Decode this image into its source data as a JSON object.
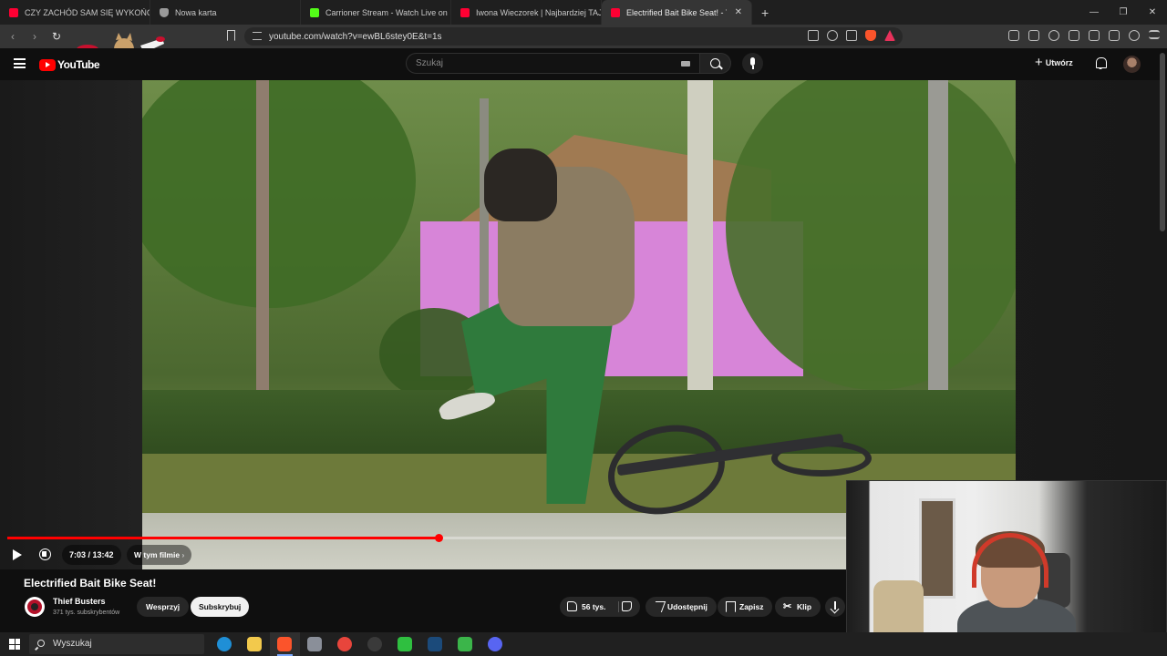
{
  "browser": {
    "tabs": [
      {
        "title": "CZY ZACHÓD SAM SIĘ WYKOŃCZY?",
        "icon": "youtube-icon",
        "color": "#ff0033"
      },
      {
        "title": "Nowa karta",
        "icon": "brave-shield-icon",
        "color": "#9a9a9a"
      },
      {
        "title": "Carrioner Stream - Watch Live on Kick",
        "icon": "kick-icon",
        "color": "#53fc18"
      },
      {
        "title": "Iwona Wieczorek | Najbardziej TAJEMNICZE",
        "icon": "youtube-icon",
        "color": "#ff0033"
      },
      {
        "title": "Electrified Bait Bike Seat! - YouTube",
        "icon": "youtube-icon",
        "color": "#ff0033"
      }
    ],
    "active_tab": 4,
    "url": "youtube.com/watch?v=ewBL6stey0E&t=1s"
  },
  "youtube": {
    "logo_text": "YouTube",
    "search_placeholder": "Szukaj",
    "create_label": "Utwórz"
  },
  "player": {
    "current_time": "7:03",
    "duration": "13:42",
    "time_display": "7:03 / 13:42",
    "progress_fraction": 0.5146,
    "chapters_label": "W tym filmie",
    "accent": "#ff0000"
  },
  "video": {
    "title": "Electrified Bait Bike Seat!",
    "channel_name": "Thief Busters",
    "subscribers": "371 tys. subskrybentów",
    "support_label": "Wesprzyj",
    "subscribe_label": "Subskrybuj",
    "likes": "56 tys.",
    "share_label": "Udostępnij",
    "save_label": "Zapisz",
    "clip_label": "Klip"
  },
  "taskbar": {
    "search_placeholder": "Wyszukaj",
    "apps": [
      {
        "name": "edge-icon",
        "color": "#1f8fd6"
      },
      {
        "name": "file-explorer-icon",
        "color": "#f2c94c"
      },
      {
        "name": "brave-icon",
        "color": "#fb542b"
      },
      {
        "name": "app-icon",
        "color": "#8a8f99"
      },
      {
        "name": "chrome-icon",
        "color": "#e8453c"
      },
      {
        "name": "obs-icon",
        "color": "#3a3a3a"
      },
      {
        "name": "media-player-icon",
        "color": "#2fbf40"
      },
      {
        "name": "steam-icon",
        "color": "#1b4a7a"
      },
      {
        "name": "app-green-icon",
        "color": "#3bb54a"
      },
      {
        "name": "discord-icon",
        "color": "#5865f2"
      }
    ]
  }
}
